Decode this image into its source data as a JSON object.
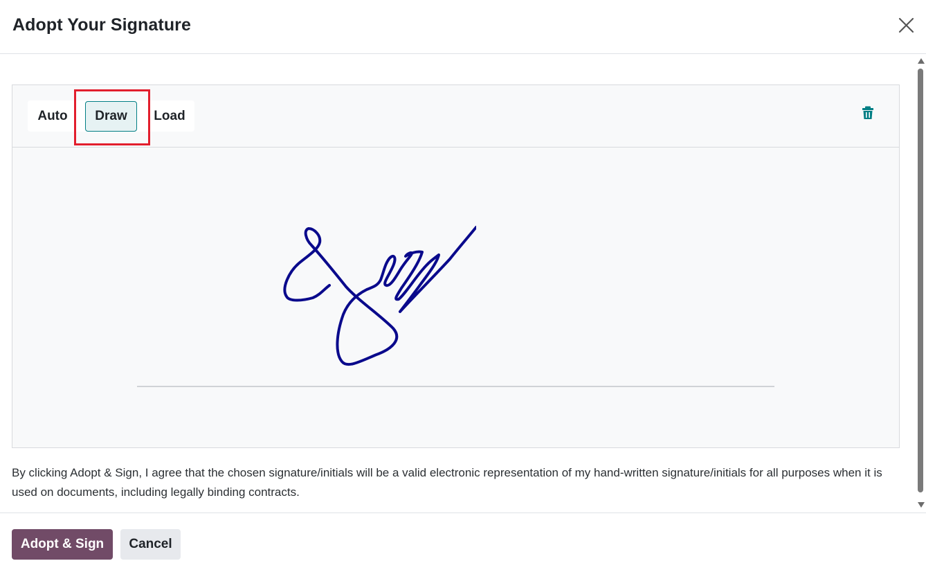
{
  "dialog": {
    "title": "Adopt Your Signature",
    "close_icon": "close-icon"
  },
  "signature": {
    "modes": [
      "Auto",
      "Draw",
      "Load"
    ],
    "active_mode": "Draw",
    "delete_icon": "trash-icon",
    "ink_color": "#0a0a8c"
  },
  "legal_text": "By clicking Adopt & Sign, I agree that the chosen signature/initials will be a valid electronic representation of my hand-written signature/initials for all purposes when it is used on documents, including legally binding contracts.",
  "footer": {
    "adopt_label": "Adopt & Sign",
    "cancel_label": "Cancel"
  },
  "colors": {
    "primary": "#714b67",
    "accent": "#017e84",
    "highlight": "#e21e2d"
  }
}
